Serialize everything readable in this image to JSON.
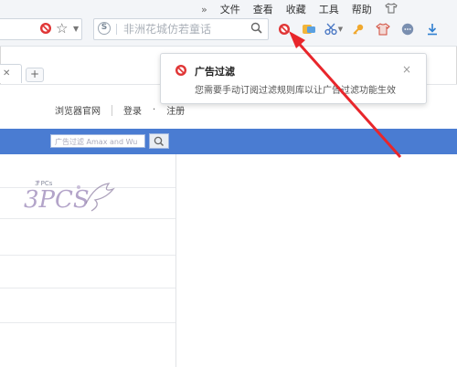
{
  "menu": {
    "overflow": "»",
    "items": [
      "文件",
      "查看",
      "收藏",
      "工具",
      "帮助"
    ]
  },
  "search": {
    "placeholder": "非洲花城仿若童话",
    "engine_letter": "S"
  },
  "tabs": {
    "new_tab": "+"
  },
  "page": {
    "nav_links": [
      "浏览器官网",
      "登录",
      "·",
      "注册"
    ],
    "search_placeholder": "广告过滤 Amax and Wu",
    "watermark_text": "3 PCs",
    "watermark_logo": "3PCS"
  },
  "popup": {
    "title": "广告过滤",
    "message": "您需要手动订阅过滤规则库以让广告过滤功能生效",
    "close": "×"
  },
  "colors": {
    "accent_blue": "#4a7cd2",
    "block_red": "#e03535",
    "arrow_red": "#e8262b"
  },
  "icons": {
    "address": [
      "adblock-icon",
      "star-icon",
      "chevron-down-icon"
    ],
    "toolbar": [
      "adblock-icon",
      "tools-icon",
      "scissors-icon",
      "key-icon",
      "shirt-icon",
      "chat-icon",
      "download-icon"
    ]
  }
}
